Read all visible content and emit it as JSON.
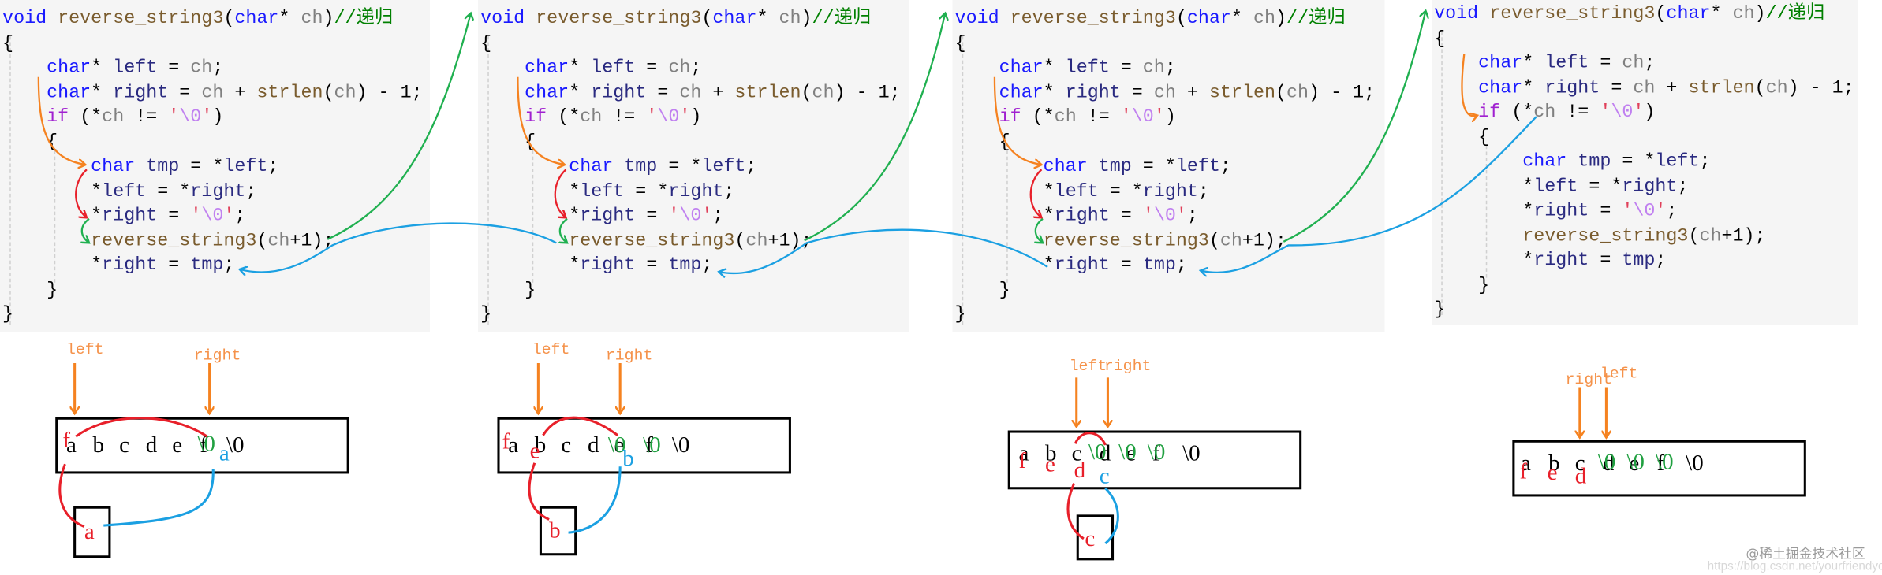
{
  "code": {
    "lines": [
      [
        [
          "void",
          "kw"
        ],
        [
          " ",
          "op"
        ],
        [
          "reverse_string3",
          "fn"
        ],
        [
          "(",
          "op"
        ],
        [
          "char",
          "kw"
        ],
        [
          "* ",
          "op"
        ],
        [
          "ch",
          "ch"
        ],
        [
          ")",
          "op"
        ],
        [
          "//递归",
          "cm"
        ]
      ],
      [
        [
          "{",
          "op"
        ]
      ],
      [
        [
          "    ",
          "op"
        ],
        [
          "char",
          "kw"
        ],
        [
          "* ",
          "op"
        ],
        [
          "left",
          "id"
        ],
        [
          " = ",
          "op"
        ],
        [
          "ch",
          "ch"
        ],
        [
          ";",
          "op"
        ]
      ],
      [
        [
          "    ",
          "op"
        ],
        [
          "char",
          "kw"
        ],
        [
          "* ",
          "op"
        ],
        [
          "right",
          "id"
        ],
        [
          " = ",
          "op"
        ],
        [
          "ch",
          "ch"
        ],
        [
          " + ",
          "op"
        ],
        [
          "strlen",
          "fn"
        ],
        [
          "(",
          "op"
        ],
        [
          "ch",
          "ch"
        ],
        [
          ") - 1;",
          "op"
        ]
      ],
      [
        [
          "    ",
          "op"
        ],
        [
          "if",
          "ctl"
        ],
        [
          " (*",
          "op"
        ],
        [
          "ch",
          "ch"
        ],
        [
          " != ",
          "op"
        ],
        [
          "'",
          "q"
        ],
        [
          "\\0",
          "esc"
        ],
        [
          "'",
          "q"
        ],
        [
          ")",
          "op"
        ]
      ],
      [
        [
          "    {",
          "op"
        ]
      ],
      [
        [
          "        ",
          "op"
        ],
        [
          "char",
          "kw"
        ],
        [
          " ",
          "op"
        ],
        [
          "tmp",
          "id"
        ],
        [
          " = *",
          "op"
        ],
        [
          "left",
          "id"
        ],
        [
          ";",
          "op"
        ]
      ],
      [
        [
          "        *",
          "op"
        ],
        [
          "left",
          "id"
        ],
        [
          " = *",
          "op"
        ],
        [
          "right",
          "id"
        ],
        [
          ";",
          "op"
        ]
      ],
      [
        [
          "        *",
          "op"
        ],
        [
          "right",
          "id"
        ],
        [
          " = ",
          "op"
        ],
        [
          "'",
          "q"
        ],
        [
          "\\0",
          "esc"
        ],
        [
          "'",
          "q"
        ],
        [
          ";",
          "op"
        ]
      ],
      [
        [
          "        ",
          "op"
        ],
        [
          "reverse_string3",
          "fn"
        ],
        [
          "(",
          "op"
        ],
        [
          "ch",
          "ch"
        ],
        [
          "+1);",
          "op"
        ]
      ],
      [
        [
          "        *",
          "op"
        ],
        [
          "right",
          "id"
        ],
        [
          " = ",
          "op"
        ],
        [
          "tmp",
          "id"
        ],
        [
          ";",
          "op"
        ]
      ],
      [
        [
          "    }",
          "op"
        ]
      ],
      [
        [
          "}",
          "op"
        ]
      ]
    ]
  },
  "diagrams": [
    {
      "left_label": "left",
      "right_label": "right",
      "chars": [
        "a",
        "b",
        "c",
        "d",
        "e",
        "f",
        "\\0"
      ],
      "overlays": {
        "red": [
          "f"
        ],
        "green": [
          "\\0"
        ],
        "blue": [
          "a"
        ]
      },
      "tmp": "a"
    },
    {
      "left_label": "left",
      "right_label": "right",
      "chars": [
        "a",
        "b",
        "c",
        "d",
        "e",
        "f",
        "\\0"
      ],
      "overlays": {
        "red": [
          "f",
          "e"
        ],
        "green": [
          "\\0",
          "\\0"
        ],
        "blue": [
          "b"
        ]
      },
      "tmp": "b"
    },
    {
      "left_label": "left",
      "right_label": "right",
      "chars": [
        "a",
        "b",
        "c",
        "d",
        "e",
        "f",
        "\\0"
      ],
      "overlays": {
        "red": [
          "f",
          "e",
          "d"
        ],
        "green": [
          "\\0",
          "\\0",
          "\\0"
        ],
        "blue": [
          "c"
        ]
      },
      "tmp": "c"
    },
    {
      "left_label": "left",
      "right_label": "right",
      "chars": [
        "a",
        "b",
        "c",
        "d",
        "e",
        "f",
        "\\0"
      ],
      "overlays": {
        "red": [
          "f",
          "e",
          "d"
        ],
        "green": [
          "\\0",
          "\\0",
          "\\0"
        ]
      }
    }
  ],
  "watermark": {
    "brand": "@稀土掘金技术社区",
    "url": "https://blog.csdn.net/yourfriendyo"
  },
  "colors": {
    "call_arrow": "#20b050",
    "return_arrow": "#1ba0e2",
    "pointer_arrow": "#f58220",
    "swap_arrow": "#e8202a",
    "code_bg": "#f5f5f5"
  }
}
